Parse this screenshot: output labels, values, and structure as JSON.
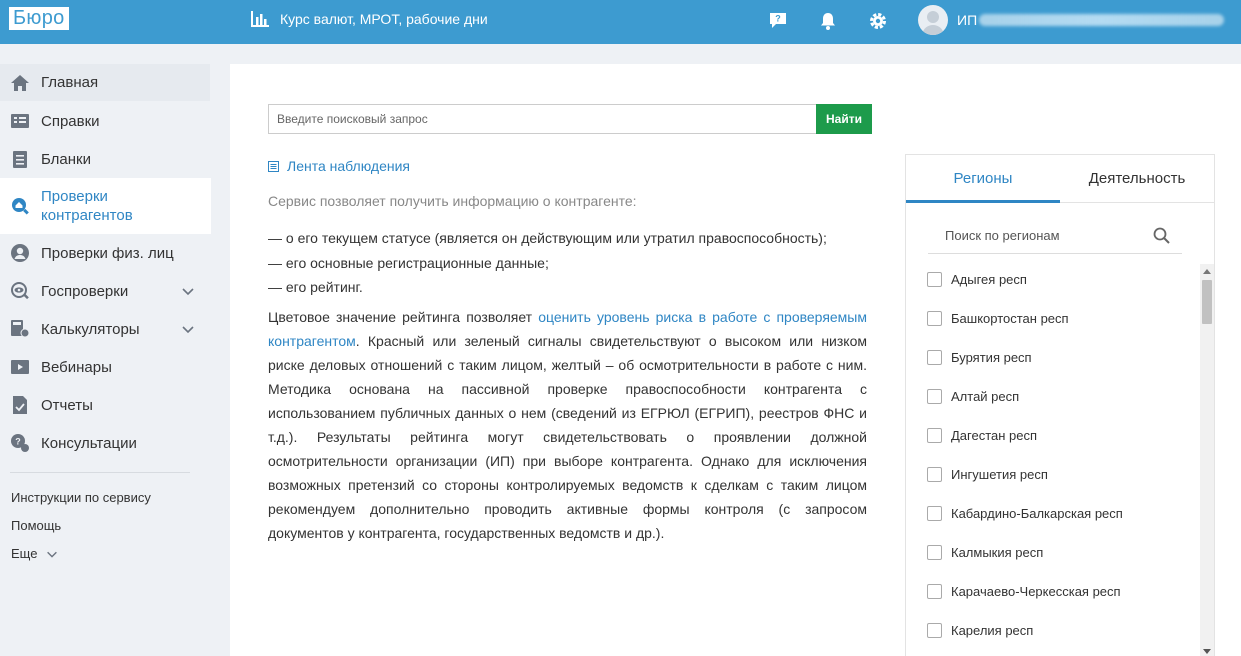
{
  "header": {
    "logo": "Бюро",
    "link_label": "Курс валют, МРОТ, рабочие дни",
    "user_prefix": "ИП",
    "help_badge": "?"
  },
  "sidebar": {
    "items": [
      {
        "label": "Главная"
      },
      {
        "label": "Справки"
      },
      {
        "label": "Бланки"
      },
      {
        "label": "Проверки\nконтрагентов"
      },
      {
        "label": "Проверки физ. лиц"
      },
      {
        "label": "Госпроверки"
      },
      {
        "label": "Калькуляторы"
      },
      {
        "label": "Вебинары"
      },
      {
        "label": "Отчеты"
      },
      {
        "label": "Консультации"
      }
    ],
    "links": [
      "Инструкции по сервису",
      "Помощь",
      "Еще"
    ]
  },
  "search": {
    "placeholder": "Введите поисковый запрос",
    "button": "Найти"
  },
  "content": {
    "feed_link": "Лента наблюдения",
    "intro": "Сервис позволяет получить информацию о контрагенте:",
    "bullets": [
      "— о его текущем статусе (является он действующим или утратил правоспособность);",
      "— его основные регистрационные данные;",
      "— его рейтинг."
    ],
    "para_before": "Цветовое значение рейтинга позволяет ",
    "para_link": "оценить уровень риска в работе с проверяемым контрагентом",
    "para_after": ". Красный или зеленый сигналы свидетельствуют о высоком или низком риске деловых отношений с таким лицом, желтый – об осмотрительности в работе с ним. Методика основана на пассивной проверке правоспособности контрагента с использованием публичных данных о нем (сведений из ЕГРЮЛ (ЕГРИП), реестров ФНС и т.д.). Результаты рейтинга могут свидетельствовать о проявлении должной осмотрительности организации (ИП) при выборе контрагента. Однако для исключения возможных претензий со стороны контролируемых ведомств к сделкам с таким лицом рекомендуем дополнительно проводить активные формы контроля (с запросом документов у контрагента, государственных ведомств и др.)."
  },
  "panel": {
    "tabs": [
      "Регионы",
      "Деятельность"
    ],
    "region_search_placeholder": "Поиск по регионам",
    "regions": [
      "Адыгея респ",
      "Башкортостан респ",
      "Бурятия респ",
      "Алтай респ",
      "Дагестан респ",
      "Ингушетия респ",
      "Кабардино-Балкарская респ",
      "Калмыкия респ",
      "Карачаево-Черкесская респ",
      "Карелия респ"
    ]
  },
  "colors": {
    "header": "#3d9bd0",
    "accent": "#2f86c4",
    "button": "#1d9b4b"
  }
}
